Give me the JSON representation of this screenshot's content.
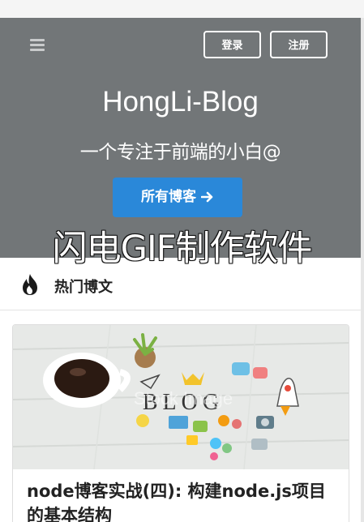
{
  "header": {
    "login_label": "登录",
    "register_label": "注册",
    "site_title": "HongLi-Blog",
    "site_subtitle": "一个专注于前端的小白@",
    "all_posts_label": "所有博客"
  },
  "overlay": {
    "watermark_text": "闪电GIF制作软件"
  },
  "section": {
    "title": "热门博文"
  },
  "card": {
    "image_text": "BLOG",
    "image_watermark": "Stock Image",
    "title": "node博客实战(四): 构建node.js项目的基本结构"
  },
  "colors": {
    "hero_bg": "#727678",
    "accent": "#2a88d9",
    "text_dark": "#222222"
  },
  "icons": {
    "menu": "hamburger-icon",
    "arrow": "arrow-right-icon",
    "section": "fire-icon"
  }
}
